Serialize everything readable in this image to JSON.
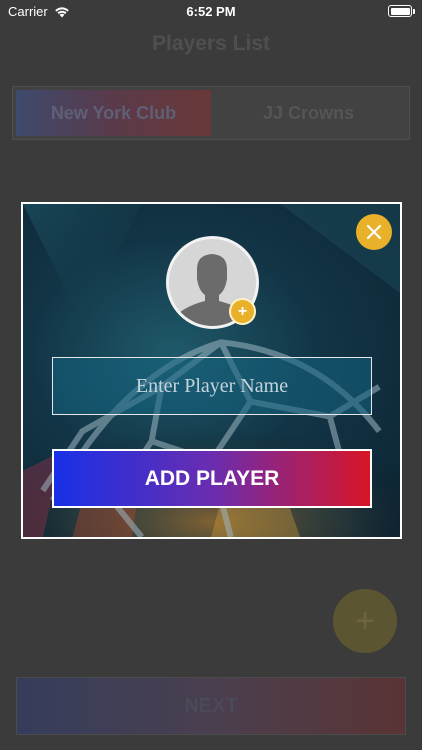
{
  "status_bar": {
    "carrier": "Carrier",
    "time": "6:52 PM"
  },
  "screen": {
    "title": "Players List",
    "teams": [
      "New York Club",
      "JJ Crowns"
    ],
    "add_fab_symbol": "+",
    "next_label": "NEXT"
  },
  "modal": {
    "close_icon": "close-icon",
    "avatar_icon": "person-silhouette-icon",
    "avatar_add_symbol": "+",
    "player_name_placeholder": "Enter Player Name",
    "player_name_value": "",
    "add_button_label": "ADD PLAYER"
  },
  "colors": {
    "accent_gold": "#e9b12a",
    "gradient_start": "#1830e6",
    "gradient_end": "#d81526"
  }
}
